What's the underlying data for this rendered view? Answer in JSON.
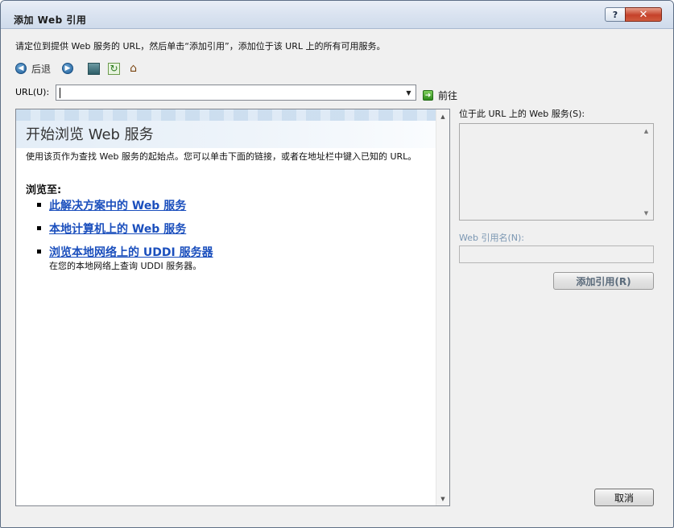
{
  "window": {
    "title": "添加 Web 引用",
    "help_glyph": "?",
    "close_glyph": "✕"
  },
  "description": "请定位到提供 Web 服务的 URL，然后单击“添加引用”，添加位于该 URL 上的所有可用服务。",
  "toolbar": {
    "back_label": "后退",
    "icons": [
      "back-arrow-icon",
      "forward-arrow-icon",
      "stop-icon",
      "refresh-icon",
      "home-icon"
    ]
  },
  "url": {
    "label": "URL(U):",
    "value": "",
    "go_label": "前往"
  },
  "browser": {
    "heading": "开始浏览 Web 服务",
    "intro": "使用该页作为查找 Web 服务的起始点。您可以单击下面的链接，或者在地址栏中键入已知的 URL。",
    "browse_to": "浏览至:",
    "links": [
      {
        "label": "此解决方案中的 Web 服务",
        "sub": ""
      },
      {
        "label": "本地计算机上的 Web 服务",
        "sub": ""
      },
      {
        "label": "浏览本地网络上的 UDDI 服务器",
        "sub": "在您的本地网络上查询 UDDI 服务器。"
      }
    ]
  },
  "services": {
    "label": "位于此 URL 上的 Web 服务(S):"
  },
  "reference": {
    "label": "Web 引用名(N):",
    "value": "",
    "add_button": "添加引用(R)"
  },
  "cancel_button": "取消",
  "colors": {
    "link": "#1b4fbd",
    "title_bar": "#dbe4f1",
    "close_button": "#c5412a"
  }
}
